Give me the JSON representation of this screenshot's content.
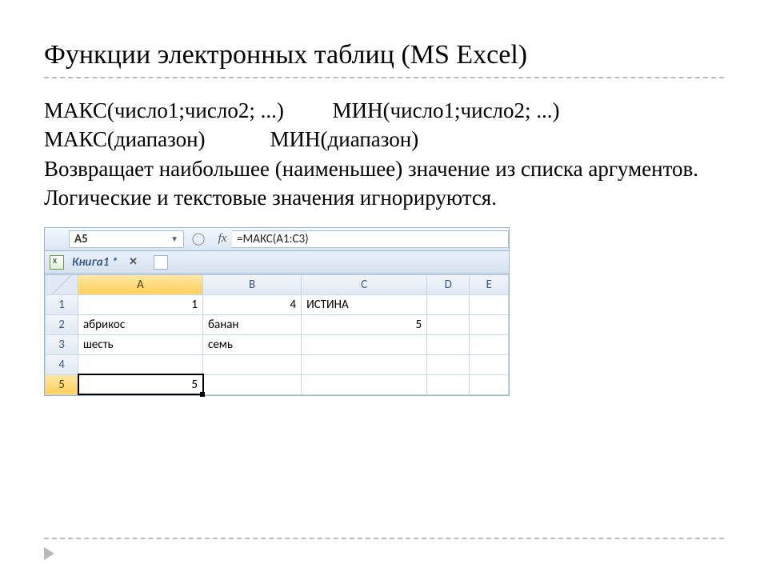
{
  "title": "Функции электронных таблиц (MS Excel)",
  "body": {
    "sig1a": "МАКС(число1;число2; ...)",
    "sig1b": "МИН(число1;число2; ...)",
    "sig2a": "МАКС(диапазон)",
    "sig2b": "МИН(диапазон)",
    "desc": "Возвращает наибольшее (наименьшее) значение из списка аргументов. Логические и текстовые значения игнорируются."
  },
  "excel": {
    "namebox": "A5",
    "fx_label": "fx",
    "formula": "=МАКС(A1:C3)",
    "tab_label": "Книга1 *",
    "tab_close": "✕",
    "columns": [
      "A",
      "B",
      "C",
      "D",
      "E"
    ],
    "rows": [
      "1",
      "2",
      "3",
      "4",
      "5"
    ],
    "cells": {
      "r1": {
        "A": "1",
        "B": "4",
        "C": "ИСТИНА",
        "D": "",
        "E": ""
      },
      "r2": {
        "A": "абрикос",
        "B": "банан",
        "C": "5",
        "D": "",
        "E": ""
      },
      "r3": {
        "A": "шесть",
        "B": "семь",
        "C": "",
        "D": "",
        "E": ""
      },
      "r4": {
        "A": "",
        "B": "",
        "C": "",
        "D": "",
        "E": ""
      },
      "r5": {
        "A": "5",
        "B": "",
        "C": "",
        "D": "",
        "E": ""
      }
    }
  }
}
